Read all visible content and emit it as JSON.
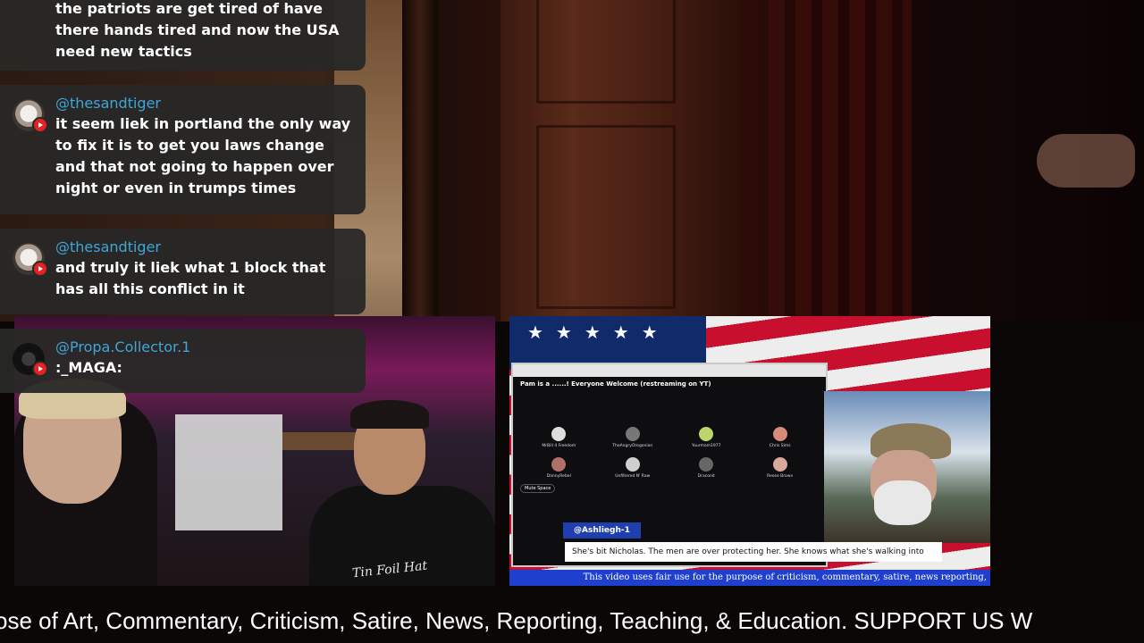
{
  "chat": [
    {
      "avatar": "channel-avatar",
      "username": "",
      "text": "the patriots are get tired of have there hands tired and now the USA need new tactics"
    },
    {
      "avatar": "tiger-avatar",
      "username": "@thesandtiger",
      "text": "it seem liek in portland the only way to fix it is to get you laws change and that not going to happen over night or even in trumps times"
    },
    {
      "avatar": "tiger-avatar",
      "username": "@thesandtiger",
      "text": "and truly it liek what 1 block that has all this conflict in it"
    },
    {
      "avatar": "propa-avatar",
      "username": "@Propa.Collector.1",
      "text": ":_MAGA:"
    }
  ],
  "left_feed": {
    "shirt_text": "Tin Foil Hat"
  },
  "right_feed": {
    "space_title": "Pam is a ......!  Everyone Welcome (restreaming on YT)",
    "participants": [
      "MrBill 4 Freedom",
      "TheAngryOregonian",
      "Yourmom1977",
      "Chris Sims",
      "DannyRebel",
      "Unfiltered N' Raw",
      "Draconit",
      "Reese Brown"
    ],
    "button_label": "Mute Space",
    "name_tag": "@Ashliegh-1",
    "lower_third": "She's bit Nicholas. The men are over protecting her. She knows what she's walking into",
    "disclaimer": "This video uses fair use for the purpose of criticism, commentary, satire, news reporting,"
  },
  "ticker": {
    "text": "ose of Art, Commentary, Criticism, Satire, News, Reporting, Teaching, & Education. SUPPORT US W"
  },
  "colors": {
    "chat_bg": "#282826",
    "username": "#3ea6d8",
    "youtube_badge": "#e52222",
    "disclaimer_bg": "#1f3fcf"
  }
}
